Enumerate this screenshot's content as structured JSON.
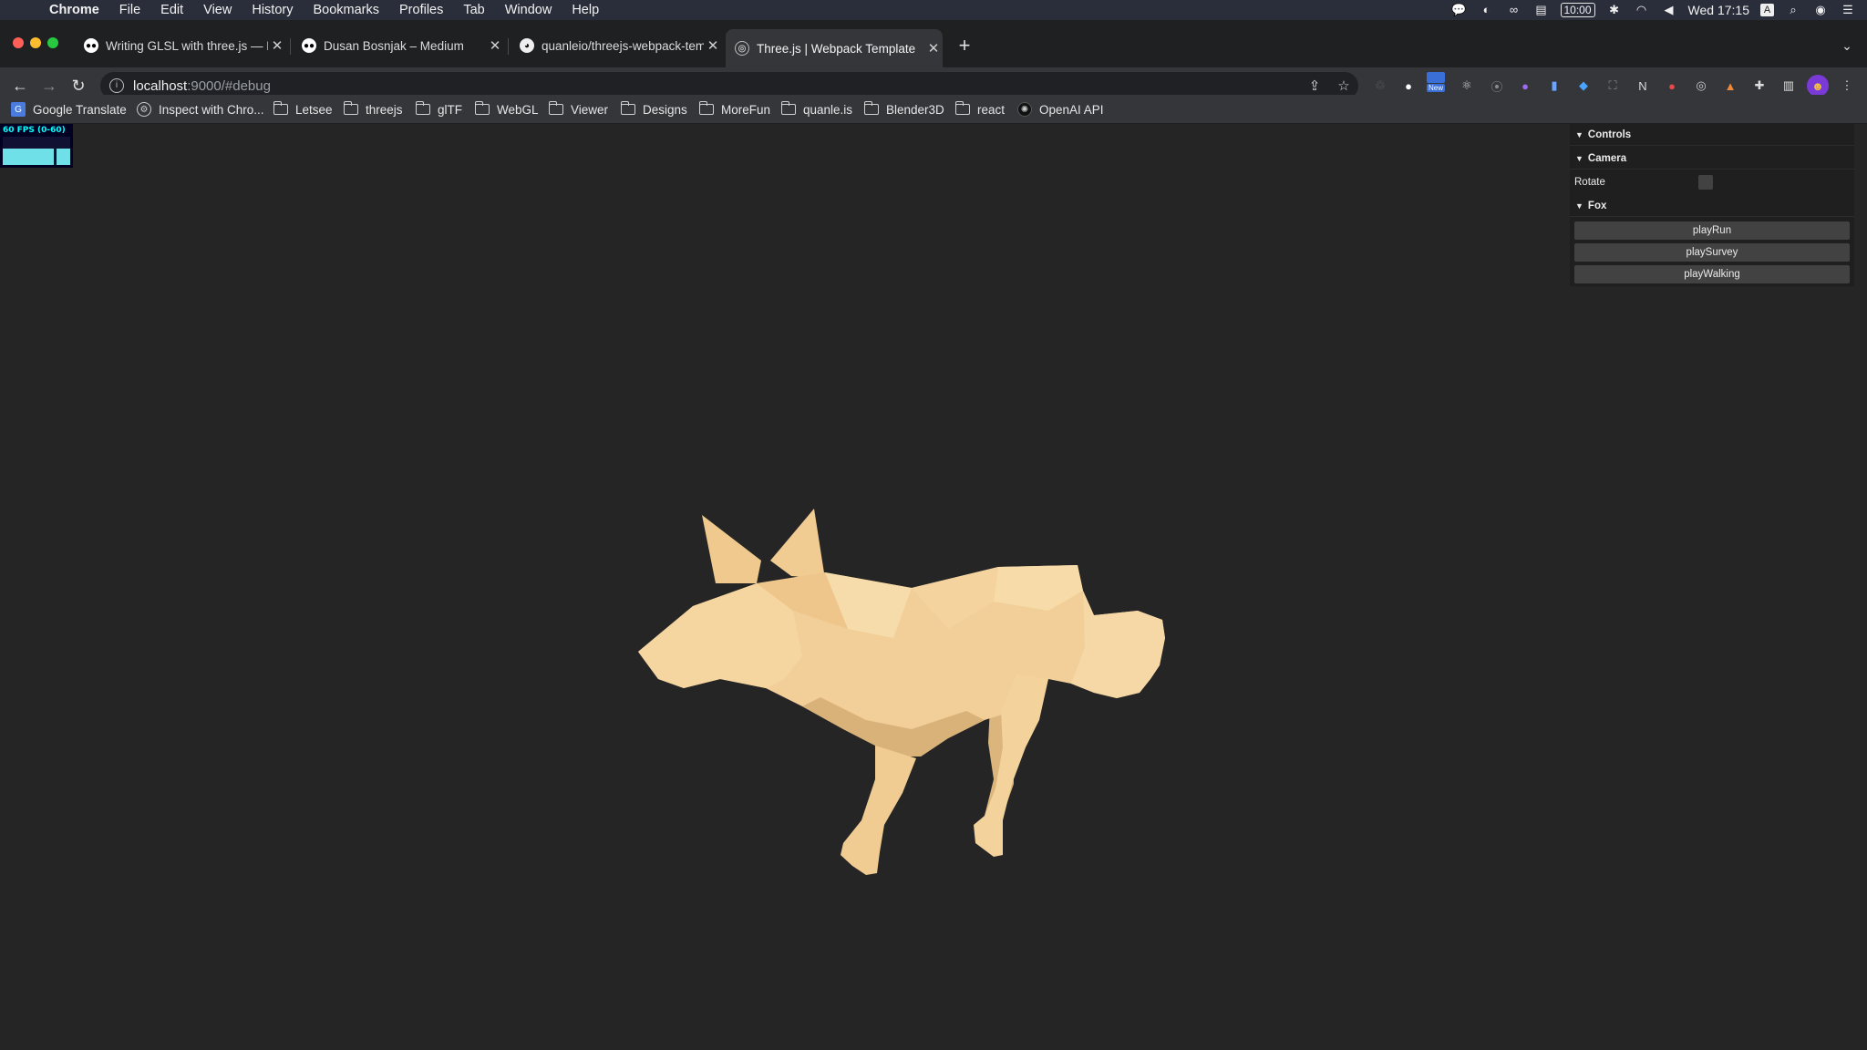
{
  "menubar": {
    "app_name": "Chrome",
    "items": [
      "File",
      "Edit",
      "View",
      "History",
      "Bookmarks",
      "Profiles",
      "Tab",
      "Window",
      "Help"
    ],
    "clock_badge": "10:00",
    "datetime": "Wed 17:15"
  },
  "tabs": [
    {
      "title": "Writing GLSL with three.js — P",
      "favicon": "medium-icon"
    },
    {
      "title": "Dusan Bosnjak – Medium",
      "favicon": "medium-icon"
    },
    {
      "title": "quanleio/threejs-webpack-tem",
      "favicon": "github-icon"
    },
    {
      "title": "Three.js | Webpack Template",
      "favicon": "globe-icon",
      "active": true
    }
  ],
  "address": {
    "host": "localhost",
    "path": ":9000/#debug"
  },
  "extensions": {
    "new_badge": "New"
  },
  "bookmarks": [
    {
      "label": "Google Translate",
      "type": "link"
    },
    {
      "label": "Inspect with Chro...",
      "type": "link"
    },
    {
      "label": "Letsee",
      "type": "folder"
    },
    {
      "label": "threejs",
      "type": "folder"
    },
    {
      "label": "glTF",
      "type": "folder"
    },
    {
      "label": "WebGL",
      "type": "folder"
    },
    {
      "label": "Viewer",
      "type": "folder"
    },
    {
      "label": "Designs",
      "type": "folder"
    },
    {
      "label": "MoreFun",
      "type": "folder"
    },
    {
      "label": "quanle.is",
      "type": "folder"
    },
    {
      "label": "Blender3D",
      "type": "folder"
    },
    {
      "label": "react",
      "type": "folder"
    },
    {
      "label": "OpenAI API",
      "type": "link"
    }
  ],
  "stats": {
    "label": "60 FPS (0-60)"
  },
  "gui": {
    "controls_title": "Controls",
    "camera_title": "Camera",
    "rotate_label": "Rotate",
    "rotate_checked": false,
    "fox_title": "Fox",
    "buttons": [
      "playRun",
      "playSurvey",
      "playWalking"
    ]
  },
  "colors": {
    "fox": "#f2cf98",
    "background": "#252525"
  }
}
